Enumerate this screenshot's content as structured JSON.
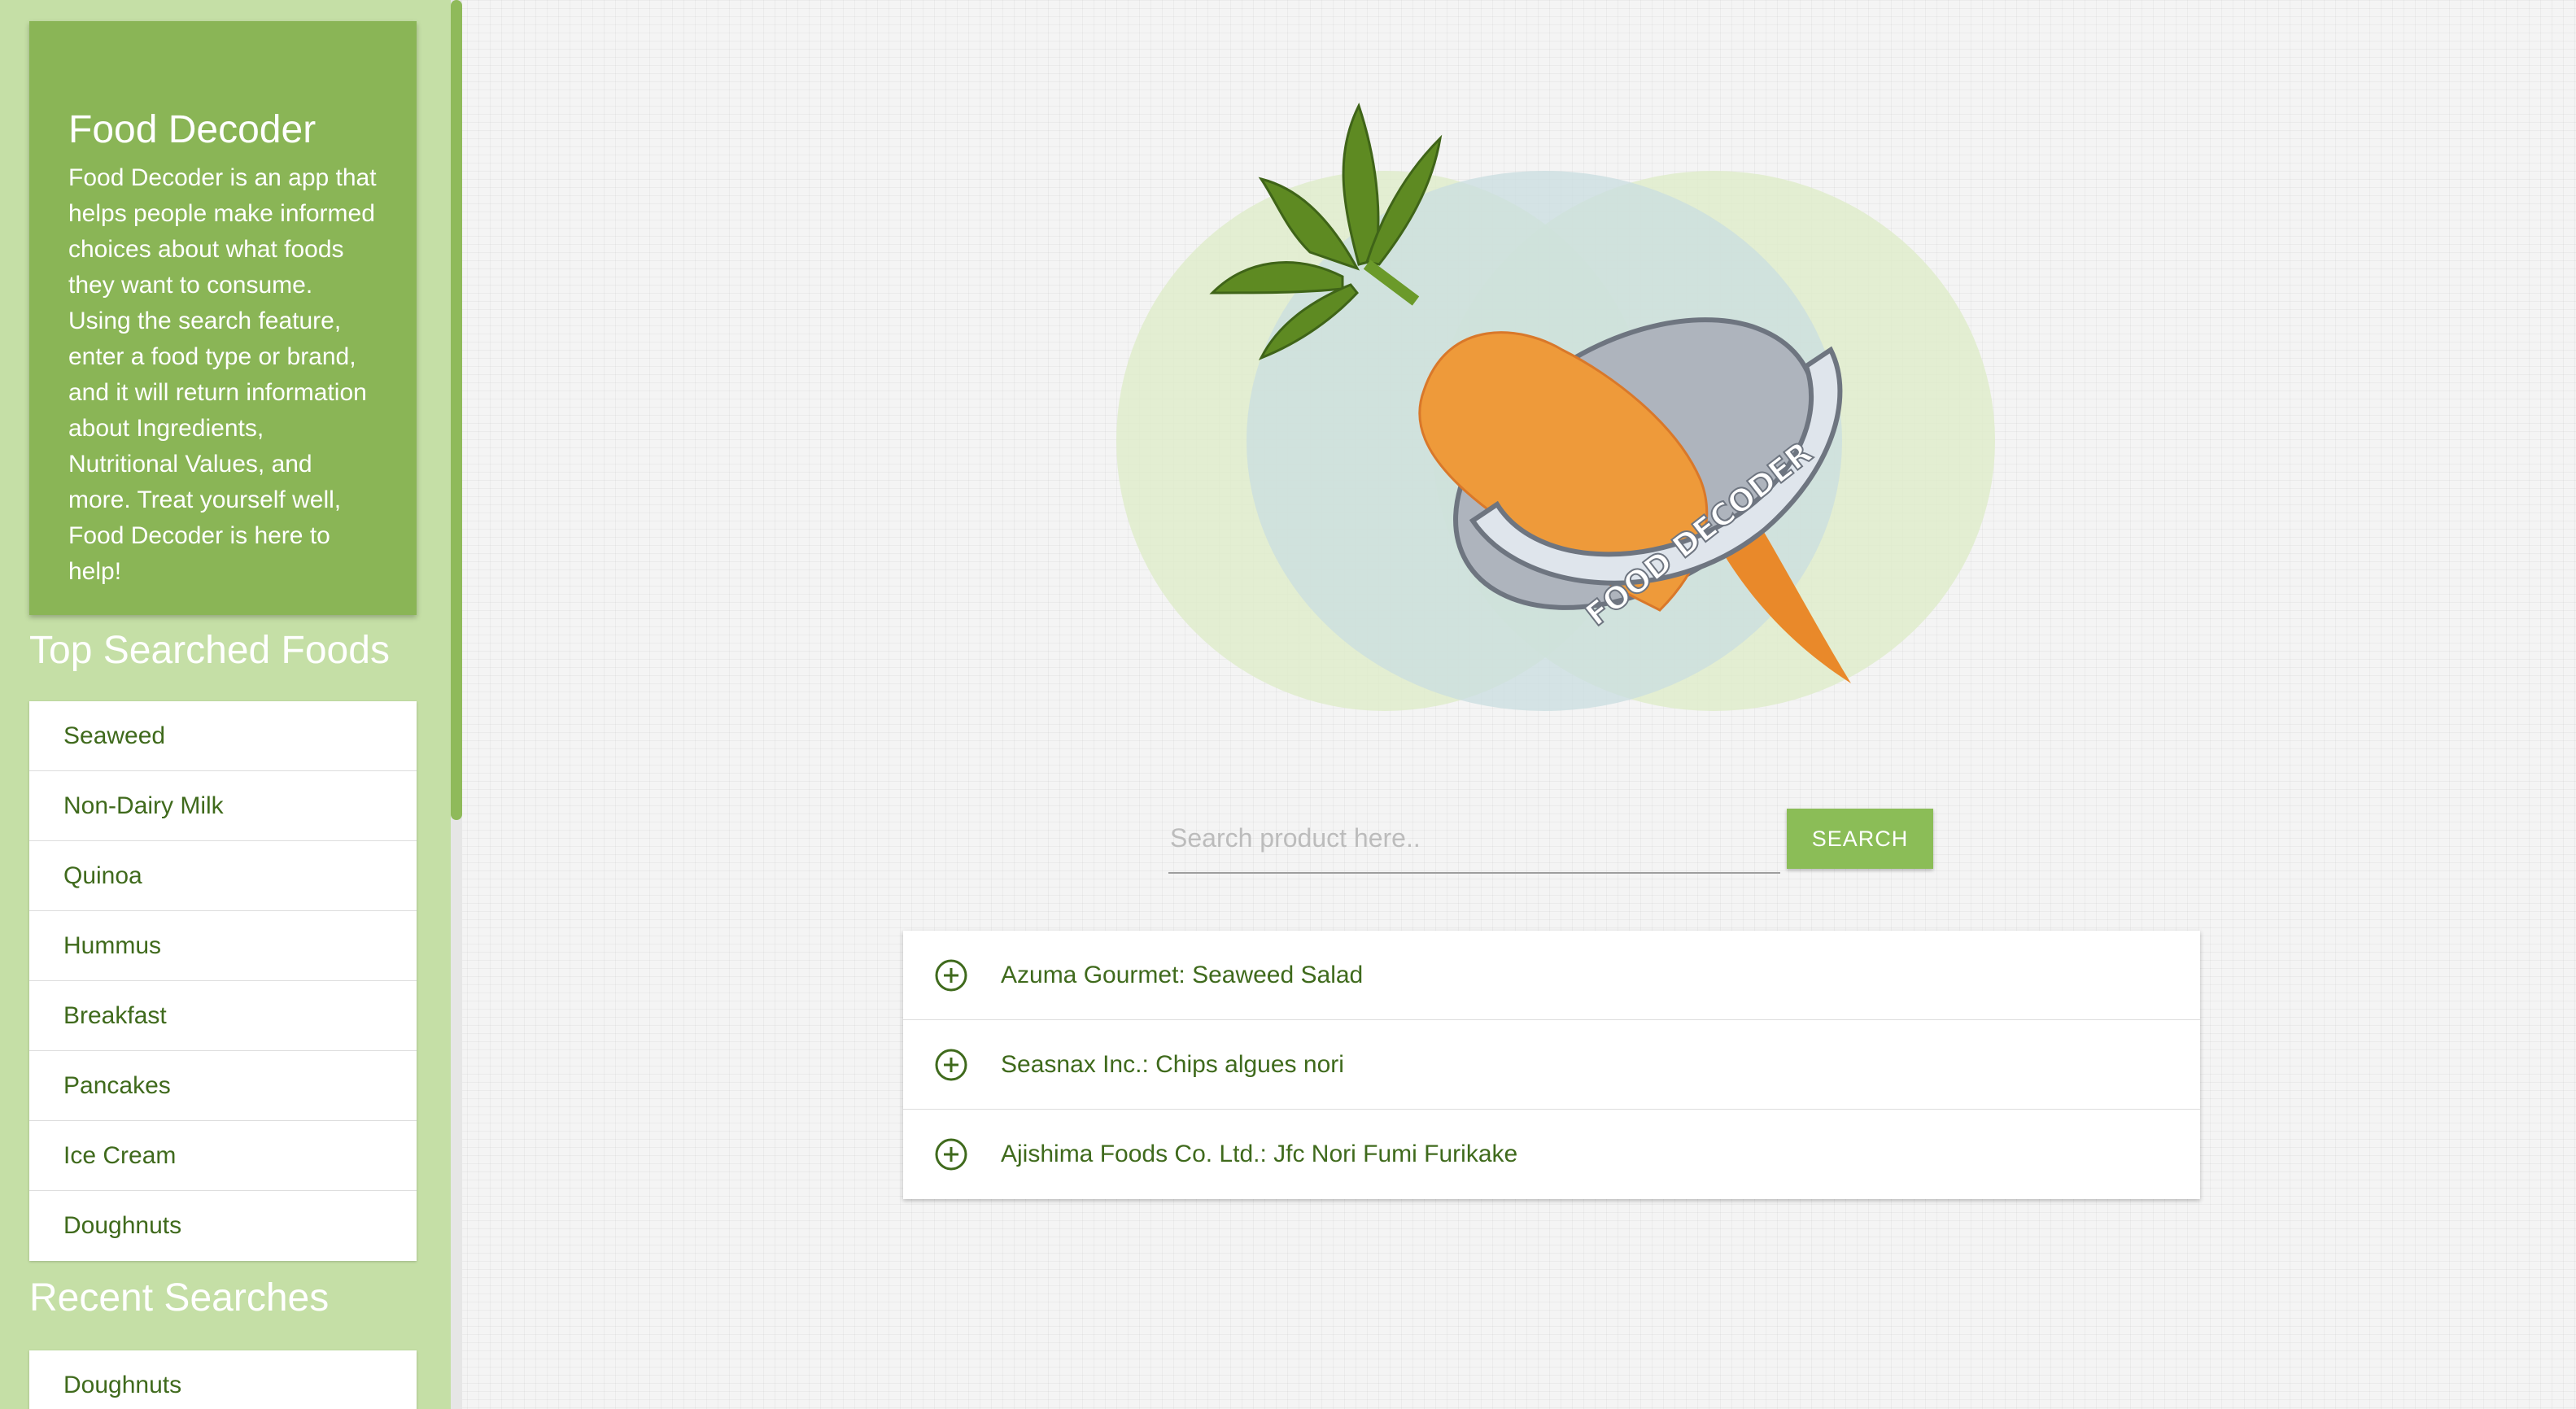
{
  "about": {
    "title": "Food Decoder",
    "text": "Food Decoder is an app that helps people make informed choices about what foods they want to consume. Using the search feature, enter a food type or brand, and it will return information about Ingredients, Nutritional Values, and more. Treat yourself well, Food Decoder is here to help!"
  },
  "top_searched": {
    "title": "Top Searched Foods",
    "items": [
      "Seaweed",
      "Non-Dairy Milk",
      "Quinoa",
      "Hummus",
      "Breakfast",
      "Pancakes",
      "Ice Cream",
      "Doughnuts"
    ]
  },
  "recent": {
    "title": "Recent Searches",
    "items": [
      "Doughnuts"
    ]
  },
  "logo": {
    "ring_text": "FOOD DECODER"
  },
  "search": {
    "placeholder": "Search product here..",
    "button_label": "SEARCH"
  },
  "results": [
    {
      "label": "Azuma Gourmet: Seaweed Salad",
      "icon": "plus-circle-icon"
    },
    {
      "label": "Seasnax Inc.: Chips algues nori",
      "icon": "plus-circle-icon"
    },
    {
      "label": "Ajishima Foods Co. Ltd.: Jfc Nori Fumi Furikake",
      "icon": "plus-circle-icon"
    }
  ],
  "colors": {
    "brand_green": "#8ab556",
    "sidebar_bg": "#c5dfa6",
    "link_green": "#3f6a1c",
    "button_green": "#8bbd57"
  }
}
